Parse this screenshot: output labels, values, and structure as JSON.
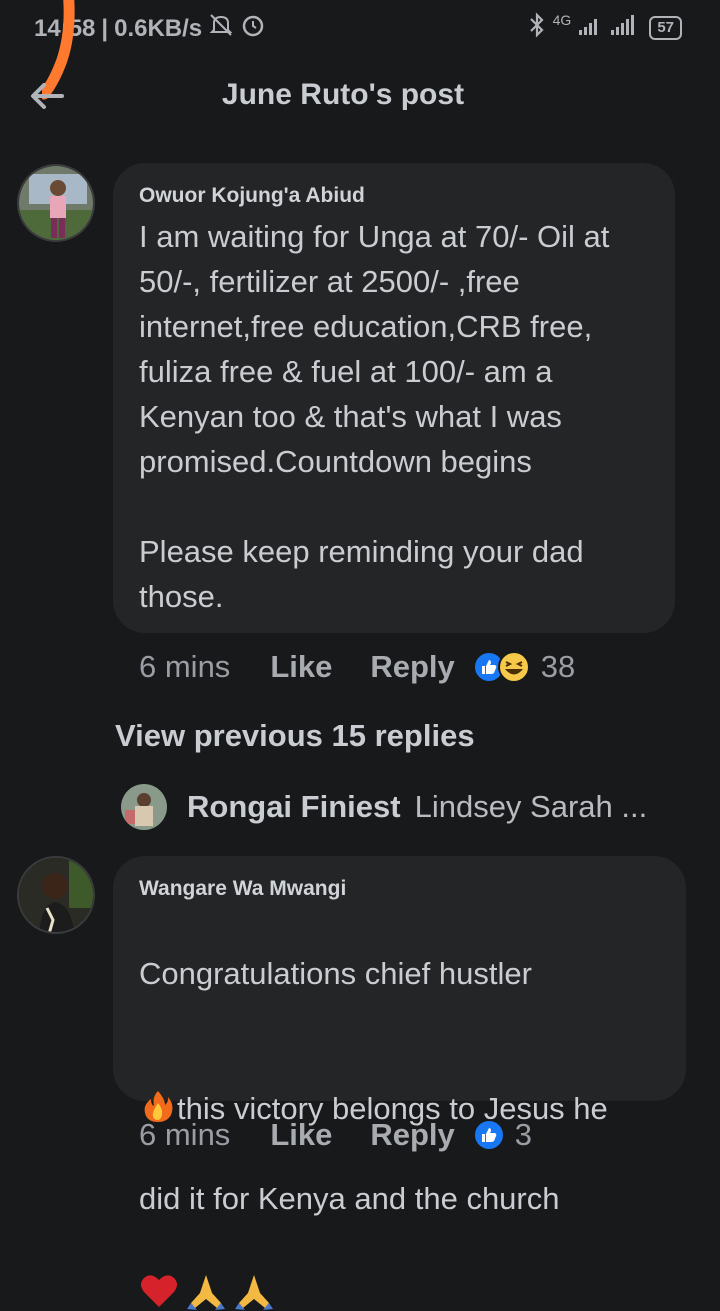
{
  "status_bar": {
    "time": "14:58",
    "speed": "0.6KB/s",
    "network": "4G",
    "battery": "57"
  },
  "header": {
    "title": "June Ruto's post"
  },
  "comments": [
    {
      "author": "Owuor Kojung'a Abiud",
      "text": "I am waiting for Unga at 70/- Oil at\n50/-, fertilizer at 2500/- ,free\ninternet,free education,CRB free,\nfuliza free & fuel at 100/- am a\nKenyan too & that's what I was\npromised.Countdown begins\n\nPlease keep reminding  your dad\nthose.",
      "time": "6 mins",
      "like_label": "Like",
      "reply_label": "Reply",
      "reaction_count": "38",
      "reactions": [
        "like-icon",
        "haha-icon"
      ]
    },
    {
      "author": "Wangare Wa Mwangi",
      "text_line1": "Congratulations chief hustler",
      "text_line2": "this victory belongs to Jesus he",
      "text_line3": "did it for Kenya and the church",
      "time": "6 mins",
      "like_label": "Like",
      "reply_label": "Reply",
      "reaction_count": "3",
      "reactions": [
        "like-icon"
      ]
    }
  ],
  "view_previous": "View previous 15 replies",
  "reply_preview": {
    "name": "Rongai Finiest",
    "text": "Lindsey Sarah ..."
  },
  "colors": {
    "background": "#18191a",
    "bubble": "#242526",
    "like_blue": "#1877f2",
    "swipe_orange": "#ff7a2f"
  }
}
